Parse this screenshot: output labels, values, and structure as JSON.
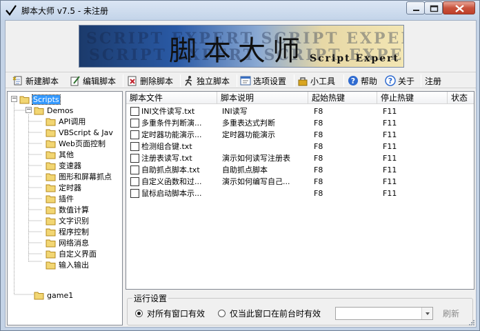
{
  "window": {
    "title": "脚本大师 v7.5 - 未注册",
    "app_icon": "check-icon"
  },
  "banner": {
    "cn_title": "脚本大师",
    "en_title": "Script Expert",
    "ghost_line1": "SCRIPT  EXPERT  SCRIPT  EXPERT",
    "ghost_line2": "SCRIPT  EXPERT  SCRIPT  EXPERT"
  },
  "toolbar": {
    "new_script": "新建脚本",
    "edit_script": "编辑脚本",
    "delete_script": "删除脚本",
    "standalone_script": "独立脚本",
    "options": "选项设置",
    "tools": "小工具",
    "help": "帮助",
    "about": "关于",
    "register": "注册"
  },
  "tree": {
    "root": "Scripts",
    "demos": "Demos",
    "children": [
      "API调用",
      "VBScript & Jav",
      "Web页面控制",
      "其他",
      "变速器",
      "图形和屏幕抓点",
      "定时器",
      "插件",
      "数值计算",
      "文字识别",
      "程序控制",
      "网络消息",
      "自定义界面",
      "输入输出"
    ],
    "game": "game1"
  },
  "list": {
    "headers": [
      "脚本文件",
      "脚本说明",
      "起始热键",
      "停止热键",
      "状态"
    ],
    "rows": [
      {
        "file": "INI文件读写.txt",
        "desc": "INI读写",
        "start": "F8",
        "stop": "F11",
        "status": ""
      },
      {
        "file": "多重条件判断演...",
        "desc": "多重表达式判断",
        "start": "F8",
        "stop": "F11",
        "status": ""
      },
      {
        "file": "定时器功能演示...",
        "desc": "定时器功能演示",
        "start": "F8",
        "stop": "F11",
        "status": ""
      },
      {
        "file": "检测组合键.txt",
        "desc": "",
        "start": "F8",
        "stop": "F11",
        "status": ""
      },
      {
        "file": "注册表读写.txt",
        "desc": "演示如何读写注册表",
        "start": "F8",
        "stop": "F11",
        "status": ""
      },
      {
        "file": "自助抓点脚本.txt",
        "desc": "自助抓点脚本",
        "start": "F8",
        "stop": "F11",
        "status": ""
      },
      {
        "file": "自定义函数和过...",
        "desc": "演示如何编写自己...",
        "start": "F8",
        "stop": "F11",
        "status": ""
      },
      {
        "file": "鼠标启动脚本示...",
        "desc": "",
        "start": "F8",
        "stop": "F11",
        "status": ""
      }
    ]
  },
  "run_settings": {
    "title": "运行设置",
    "option_all": "对所有窗口有效",
    "option_front": "仅当此窗口在前台时有效",
    "selected": "option_all",
    "window_combo_value": "",
    "refresh": "刷新"
  }
}
